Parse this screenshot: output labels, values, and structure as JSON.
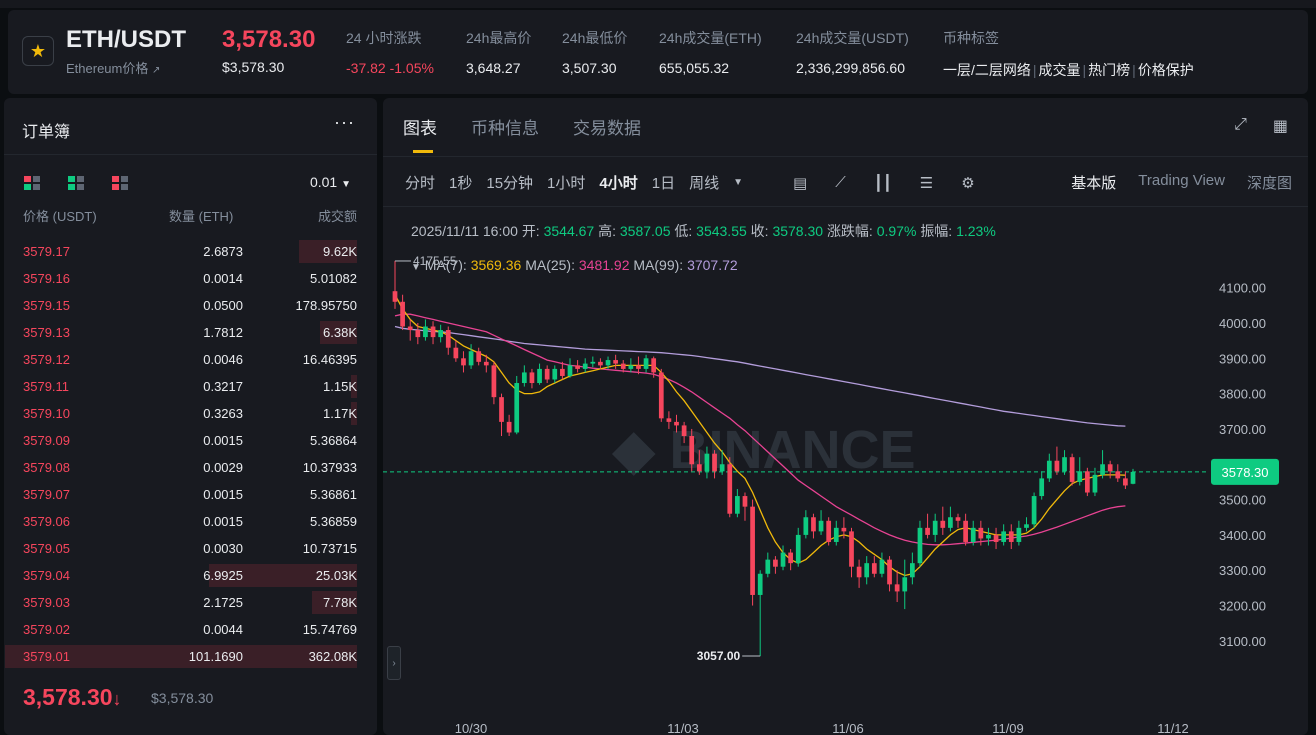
{
  "header": {
    "pair": "ETH/USDT",
    "pair_sub": "Ethereum价格",
    "last_price": "3,578.30",
    "last_price_usd": "$3,578.30",
    "stats": [
      {
        "label": "24 小时涨跌",
        "value": "-37.82 -1.05%",
        "tone": "red"
      },
      {
        "label": "24h最高价",
        "value": "3,648.27"
      },
      {
        "label": "24h最低价",
        "value": "3,507.30"
      },
      {
        "label": "24h成交量(ETH)",
        "value": "655,055.32"
      },
      {
        "label": "24h成交量(USDT)",
        "value": "2,336,299,856.60"
      }
    ],
    "tags_label": "币种标签",
    "tags": [
      "一层/二层网络",
      "成交量",
      "热门榜",
      "价格保护"
    ]
  },
  "orderbook": {
    "title": "订单簿",
    "more": "···",
    "precision": "0.01",
    "col_price": "价格 (USDT)",
    "col_qty": "数量 (ETH)",
    "col_total": "成交额",
    "rows": [
      {
        "price": "3579.17",
        "qty": "2.6873",
        "total": "9.62K",
        "depth": 0.27
      },
      {
        "price": "3579.16",
        "qty": "0.0014",
        "total": "5.01082",
        "depth": 0.0
      },
      {
        "price": "3579.15",
        "qty": "0.0500",
        "total": "178.95750",
        "depth": 0.0
      },
      {
        "price": "3579.13",
        "qty": "1.7812",
        "total": "6.38K",
        "depth": 0.17
      },
      {
        "price": "3579.12",
        "qty": "0.0046",
        "total": "16.46395",
        "depth": 0.0
      },
      {
        "price": "3579.11",
        "qty": "0.3217",
        "total": "1.15K",
        "depth": 0.03
      },
      {
        "price": "3579.10",
        "qty": "0.3263",
        "total": "1.17K",
        "depth": 0.03
      },
      {
        "price": "3579.09",
        "qty": "0.0015",
        "total": "5.36864",
        "depth": 0.0
      },
      {
        "price": "3579.08",
        "qty": "0.0029",
        "total": "10.37933",
        "depth": 0.0
      },
      {
        "price": "3579.07",
        "qty": "0.0015",
        "total": "5.36861",
        "depth": 0.0
      },
      {
        "price": "3579.06",
        "qty": "0.0015",
        "total": "5.36859",
        "depth": 0.0
      },
      {
        "price": "3579.05",
        "qty": "0.0030",
        "total": "10.73715",
        "depth": 0.0
      },
      {
        "price": "3579.04",
        "qty": "6.9925",
        "total": "25.03K",
        "depth": 0.69
      },
      {
        "price": "3579.03",
        "qty": "2.1725",
        "total": "7.78K",
        "depth": 0.21
      },
      {
        "price": "3579.02",
        "qty": "0.0044",
        "total": "15.74769",
        "depth": 0.0
      },
      {
        "price": "3579.01",
        "qty": "101.1690",
        "total": "362.08K",
        "depth": 1.0
      }
    ],
    "last": "3,578.30",
    "last_arrow": "↓",
    "last_usd": "$3,578.30"
  },
  "chart_panel": {
    "tabs": [
      {
        "label": "图表",
        "active": true
      },
      {
        "label": "币种信息",
        "active": false
      },
      {
        "label": "交易数据",
        "active": false
      }
    ],
    "intervals": [
      {
        "label": "分时"
      },
      {
        "label": "1秒"
      },
      {
        "label": "15分钟"
      },
      {
        "label": "1小时"
      },
      {
        "label": "4小时",
        "active": true
      },
      {
        "label": "1日"
      },
      {
        "label": "周线"
      }
    ],
    "views": [
      {
        "label": "基本版",
        "active": true
      },
      {
        "label": "Trading View"
      },
      {
        "label": "深度图"
      }
    ],
    "ohlc": {
      "date": "2025/11/11 16:00",
      "open_label": "开:",
      "open": "3544.67",
      "high_label": "高:",
      "high": "3587.05",
      "low_label": "低:",
      "low": "3543.55",
      "close_label": "收:",
      "close": "3578.30",
      "change_label": "涨跌幅:",
      "change": "0.97%",
      "amp_label": "振幅:",
      "amp": "1.23%"
    },
    "ma": {
      "ma7_label": "MA(7):",
      "ma7": "3569.36",
      "ma25_label": "MA(25):",
      "ma25": "3481.92",
      "ma99_label": "MA(99):",
      "ma99": "3707.72"
    },
    "colors": {
      "up": "#0ecb81",
      "down": "#f6465d",
      "ma7": "#f0b90b",
      "ma25": "#e84393",
      "ma99": "#b39ddb"
    }
  },
  "chart_data": {
    "type": "candlestick",
    "ylim": [
      3060,
      4150
    ],
    "y_ticks": [
      "4100.00",
      "4000.00",
      "3900.00",
      "3800.00",
      "3700.00",
      "3600.00",
      "3500.00",
      "3400.00",
      "3300.00",
      "3200.00",
      "3100.00"
    ],
    "x_ticks": [
      "10/30",
      "11/03",
      "11/06",
      "11/09",
      "11/12"
    ],
    "current_price": 3578.3,
    "current_price_label": "3578.30",
    "high_marker": {
      "value": 4175.55,
      "label": "4175.55"
    },
    "low_marker": {
      "value": 3057.0,
      "label": "3057.00"
    },
    "candles": [
      [
        4090,
        4060,
        4176,
        4040
      ],
      [
        4060,
        3990,
        4080,
        3980
      ],
      [
        3990,
        3980,
        4010,
        3950
      ],
      [
        3980,
        3960,
        4000,
        3940
      ],
      [
        3960,
        3990,
        4010,
        3950
      ],
      [
        3990,
        3960,
        4005,
        3940
      ],
      [
        3960,
        3980,
        3995,
        3945
      ],
      [
        3980,
        3930,
        3990,
        3910
      ],
      [
        3930,
        3900,
        3950,
        3890
      ],
      [
        3900,
        3880,
        3920,
        3860
      ],
      [
        3880,
        3920,
        3940,
        3870
      ],
      [
        3920,
        3890,
        3930,
        3880
      ],
      [
        3890,
        3880,
        3910,
        3860
      ],
      [
        3880,
        3790,
        3890,
        3770
      ],
      [
        3790,
        3720,
        3800,
        3680
      ],
      [
        3720,
        3690,
        3740,
        3680
      ],
      [
        3690,
        3830,
        3850,
        3685
      ],
      [
        3830,
        3860,
        3880,
        3820
      ],
      [
        3860,
        3830,
        3870,
        3815
      ],
      [
        3830,
        3870,
        3885,
        3825
      ],
      [
        3870,
        3840,
        3880,
        3830
      ],
      [
        3840,
        3870,
        3880,
        3830
      ],
      [
        3870,
        3850,
        3890,
        3840
      ],
      [
        3850,
        3880,
        3900,
        3845
      ],
      [
        3880,
        3870,
        3895,
        3860
      ],
      [
        3870,
        3885,
        3900,
        3860
      ],
      [
        3885,
        3890,
        3905,
        3875
      ],
      [
        3890,
        3880,
        3900,
        3870
      ],
      [
        3880,
        3895,
        3905,
        3870
      ],
      [
        3895,
        3885,
        3910,
        3870
      ],
      [
        3885,
        3870,
        3895,
        3860
      ],
      [
        3870,
        3880,
        3900,
        3860
      ],
      [
        3880,
        3870,
        3905,
        3855
      ],
      [
        3870,
        3900,
        3910,
        3860
      ],
      [
        3900,
        3860,
        3905,
        3845
      ],
      [
        3860,
        3730,
        3870,
        3720
      ],
      [
        3730,
        3720,
        3750,
        3700
      ],
      [
        3720,
        3710,
        3740,
        3690
      ],
      [
        3710,
        3680,
        3720,
        3660
      ],
      [
        3680,
        3600,
        3700,
        3580
      ],
      [
        3600,
        3580,
        3640,
        3570
      ],
      [
        3580,
        3630,
        3650,
        3560
      ],
      [
        3630,
        3580,
        3640,
        3560
      ],
      [
        3580,
        3600,
        3640,
        3570
      ],
      [
        3600,
        3460,
        3620,
        3450
      ],
      [
        3460,
        3510,
        3530,
        3450
      ],
      [
        3510,
        3480,
        3520,
        3440
      ],
      [
        3480,
        3230,
        3500,
        3200
      ],
      [
        3230,
        3290,
        3300,
        3057
      ],
      [
        3290,
        3330,
        3350,
        3280
      ],
      [
        3330,
        3310,
        3340,
        3290
      ],
      [
        3310,
        3350,
        3370,
        3300
      ],
      [
        3350,
        3320,
        3360,
        3300
      ],
      [
        3320,
        3400,
        3420,
        3310
      ],
      [
        3400,
        3450,
        3470,
        3390
      ],
      [
        3450,
        3410,
        3460,
        3390
      ],
      [
        3410,
        3440,
        3470,
        3400
      ],
      [
        3440,
        3380,
        3450,
        3370
      ],
      [
        3380,
        3420,
        3440,
        3370
      ],
      [
        3420,
        3410,
        3450,
        3390
      ],
      [
        3410,
        3310,
        3420,
        3280
      ],
      [
        3310,
        3280,
        3330,
        3250
      ],
      [
        3280,
        3320,
        3340,
        3260
      ],
      [
        3320,
        3290,
        3340,
        3280
      ],
      [
        3290,
        3330,
        3350,
        3280
      ],
      [
        3330,
        3260,
        3340,
        3240
      ],
      [
        3260,
        3240,
        3300,
        3210
      ],
      [
        3240,
        3280,
        3330,
        3190
      ],
      [
        3280,
        3320,
        3350,
        3260
      ],
      [
        3320,
        3420,
        3440,
        3310
      ],
      [
        3420,
        3400,
        3460,
        3390
      ],
      [
        3400,
        3440,
        3460,
        3380
      ],
      [
        3440,
        3420,
        3480,
        3400
      ],
      [
        3420,
        3450,
        3480,
        3410
      ],
      [
        3450,
        3440,
        3460,
        3420
      ],
      [
        3440,
        3380,
        3460,
        3370
      ],
      [
        3380,
        3420,
        3440,
        3370
      ],
      [
        3420,
        3390,
        3440,
        3370
      ],
      [
        3390,
        3400,
        3420,
        3370
      ],
      [
        3400,
        3380,
        3420,
        3360
      ],
      [
        3380,
        3410,
        3430,
        3370
      ],
      [
        3410,
        3380,
        3430,
        3360
      ],
      [
        3380,
        3420,
        3440,
        3370
      ],
      [
        3420,
        3430,
        3450,
        3410
      ],
      [
        3430,
        3510,
        3520,
        3420
      ],
      [
        3510,
        3560,
        3580,
        3500
      ],
      [
        3560,
        3610,
        3630,
        3550
      ],
      [
        3610,
        3580,
        3650,
        3570
      ],
      [
        3580,
        3620,
        3640,
        3570
      ],
      [
        3620,
        3550,
        3630,
        3540
      ],
      [
        3550,
        3580,
        3620,
        3540
      ],
      [
        3580,
        3520,
        3590,
        3510
      ],
      [
        3520,
        3570,
        3590,
        3510
      ],
      [
        3570,
        3600,
        3640,
        3560
      ],
      [
        3600,
        3580,
        3610,
        3560
      ],
      [
        3580,
        3560,
        3600,
        3550
      ],
      [
        3560,
        3540,
        3580,
        3530
      ],
      [
        3544.67,
        3578.3,
        3587.05,
        3543.55
      ]
    ],
    "ma7": [
      4080,
      4040,
      4010,
      3990,
      3985,
      3980,
      3975,
      3965,
      3950,
      3935,
      3925,
      3915,
      3905,
      3890,
      3860,
      3830,
      3810,
      3800,
      3800,
      3805,
      3820,
      3830,
      3840,
      3850,
      3855,
      3860,
      3865,
      3870,
      3875,
      3880,
      3880,
      3880,
      3880,
      3880,
      3880,
      3860,
      3835,
      3805,
      3780,
      3750,
      3720,
      3690,
      3660,
      3635,
      3605,
      3580,
      3560,
      3520,
      3470,
      3420,
      3380,
      3350,
      3330,
      3320,
      3330,
      3350,
      3370,
      3385,
      3395,
      3400,
      3395,
      3380,
      3360,
      3345,
      3330,
      3310,
      3295,
      3285,
      3290,
      3310,
      3335,
      3360,
      3380,
      3400,
      3415,
      3420,
      3415,
      3410,
      3405,
      3400,
      3400,
      3400,
      3400,
      3405,
      3420,
      3445,
      3475,
      3500,
      3525,
      3545,
      3555,
      3560,
      3565,
      3570,
      3570,
      3570,
      3569
    ],
    "ma25": [
      4020,
      4025,
      4025,
      4020,
      4015,
      4010,
      4005,
      4000,
      3995,
      3990,
      3985,
      3980,
      3975,
      3965,
      3955,
      3945,
      3935,
      3925,
      3915,
      3905,
      3895,
      3890,
      3885,
      3880,
      3878,
      3875,
      3872,
      3870,
      3868,
      3866,
      3864,
      3862,
      3860,
      3858,
      3855,
      3848,
      3840,
      3830,
      3818,
      3805,
      3790,
      3775,
      3760,
      3745,
      3730,
      3712,
      3695,
      3675,
      3655,
      3635,
      3615,
      3595,
      3575,
      3555,
      3540,
      3525,
      3510,
      3495,
      3480,
      3468,
      3456,
      3444,
      3432,
      3420,
      3410,
      3400,
      3392,
      3385,
      3380,
      3376,
      3373,
      3372,
      3372,
      3373,
      3375,
      3377,
      3379,
      3381,
      3383,
      3385,
      3388,
      3391,
      3394,
      3397,
      3402,
      3408,
      3415,
      3422,
      3430,
      3438,
      3446,
      3454,
      3462,
      3470,
      3476,
      3480,
      3482
    ],
    "ma99": [
      3990,
      3985,
      3982,
      3980,
      3978,
      3976,
      3975,
      3973,
      3970,
      3967,
      3964,
      3961,
      3958,
      3955,
      3952,
      3948,
      3945,
      3942,
      3940,
      3938,
      3936,
      3934,
      3932,
      3930,
      3928,
      3926,
      3925,
      3924,
      3923,
      3922,
      3921,
      3920,
      3919,
      3918,
      3917,
      3916,
      3914,
      3912,
      3910,
      3908,
      3905,
      3902,
      3899,
      3896,
      3893,
      3890,
      3886,
      3882,
      3878,
      3874,
      3870,
      3866,
      3862,
      3858,
      3854,
      3850,
      3846,
      3842,
      3838,
      3834,
      3830,
      3826,
      3822,
      3818,
      3814,
      3810,
      3806,
      3802,
      3798,
      3794,
      3790,
      3786,
      3782,
      3778,
      3774,
      3770,
      3766,
      3762,
      3758,
      3754,
      3750,
      3747,
      3744,
      3741,
      3738,
      3735,
      3732,
      3729,
      3726,
      3723,
      3720,
      3717,
      3715,
      3713,
      3711,
      3709,
      3708
    ]
  }
}
